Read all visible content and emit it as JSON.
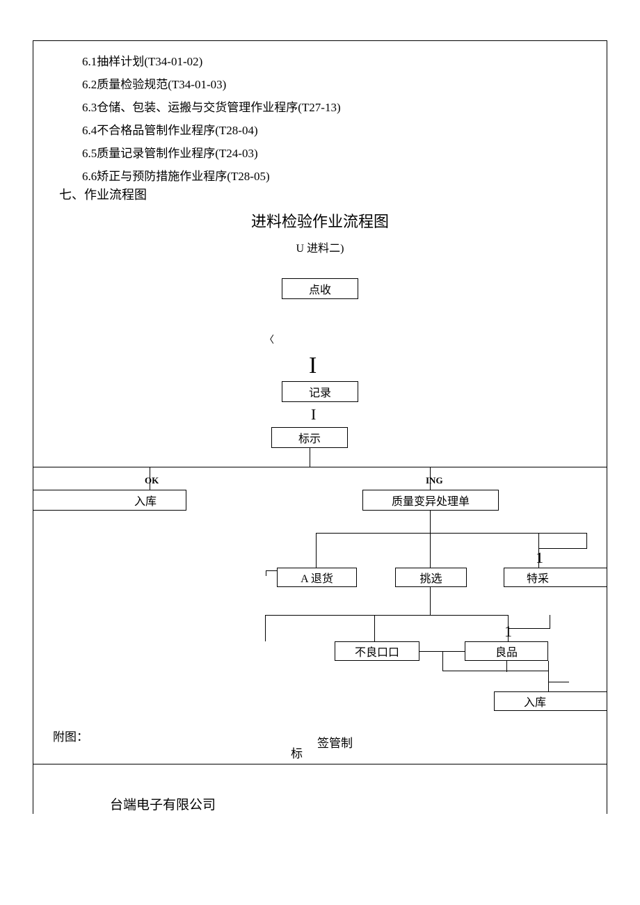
{
  "list": {
    "item1": "6.1抽样计划(T34-01-02)",
    "item2": "6.2质量检验规范(T34-01-03)",
    "item3": "6.3仓储、包装、运搬与交货管理作业程序(T27-13)",
    "item4": "6.4不合格品管制作业程序(T28-04)",
    "item5": "6.5质量记录管制作业程序(T24-03)",
    "item6": "6.6矫正与预防措施作业程序(T28-05)"
  },
  "section_title": "七、作业流程图",
  "flowchart": {
    "title": "进料检验作业流程图",
    "subtitle": "U 进料二)",
    "box_receive": "点收",
    "caret": "〈",
    "i_glyph": "I",
    "box_record": "记录",
    "box_mark": "标示",
    "ok_label": "OK",
    "ing_label": "ING",
    "box_store1": "入库",
    "box_variance": "质量变异处理单",
    "one_glyph": "1",
    "box_return": "A 退货",
    "box_pick": "挑选",
    "box_special": "特采",
    "box_defect": "不良口口",
    "box_good": "良品",
    "box_store2": "入库"
  },
  "attach_label": "附图：",
  "footer_left": "标",
  "footer_right": "签管制",
  "company": "台端电子有限公司"
}
